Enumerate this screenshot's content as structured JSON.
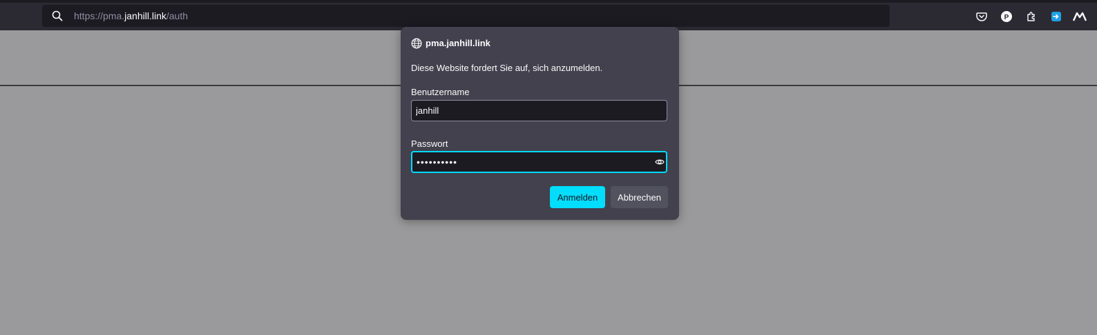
{
  "browser": {
    "url": {
      "prefix": "https://pma.",
      "host": "janhill.link",
      "path": "/auth"
    },
    "toolbar_icons": [
      "pocket-icon",
      "extension-p-icon",
      "extensions-puzzle-icon",
      "screenshot-icon",
      "profile-m-icon"
    ],
    "extension_p_label": "P"
  },
  "dialog": {
    "site": "pma.janhill.link",
    "message": "Diese Website fordert Sie auf, sich anzumelden.",
    "username_label": "Benutzername",
    "username_value": "janhill",
    "password_label": "Passwort",
    "password_value": "••••••••••",
    "login_button": "Anmelden",
    "cancel_button": "Abbrechen"
  },
  "colors": {
    "accent": "#00ddff",
    "dialog_bg": "#42414d",
    "toolbar_bg": "#2b2a33",
    "page_bg": "#9a9a9c"
  }
}
